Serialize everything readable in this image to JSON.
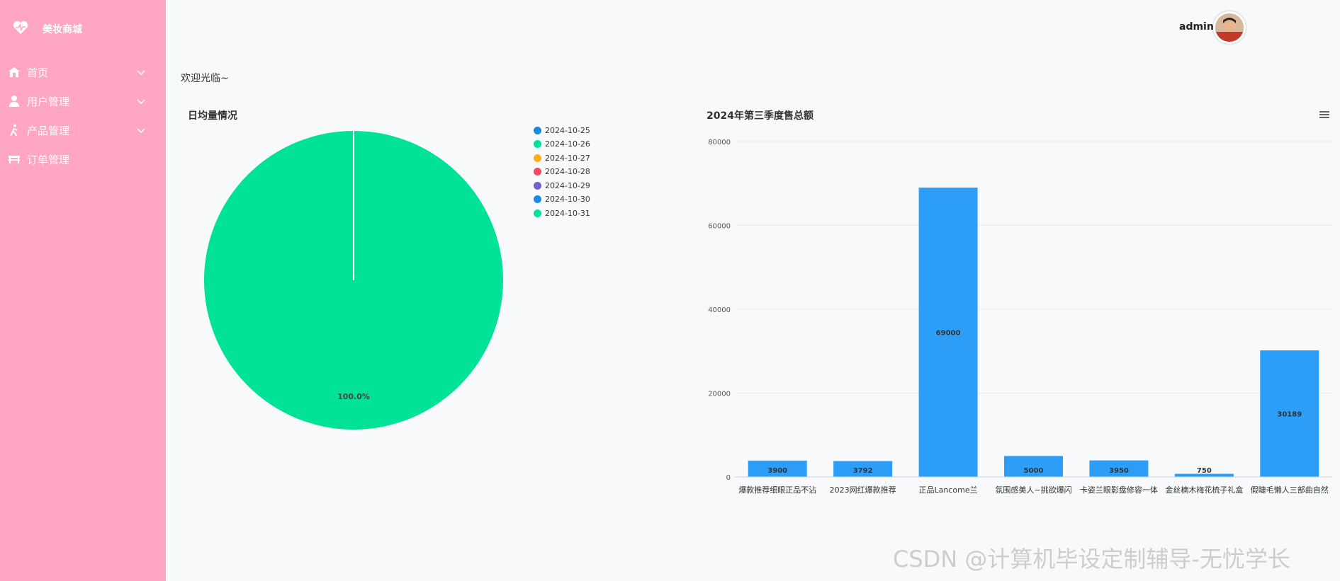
{
  "app": {
    "brand": "美妆商城"
  },
  "sidebar": {
    "items": [
      {
        "label": "首页",
        "icon": "home-icon",
        "expandable": true
      },
      {
        "label": "用户管理",
        "icon": "user-icon",
        "expandable": true
      },
      {
        "label": "产品管理",
        "icon": "walk-icon",
        "expandable": true
      },
      {
        "label": "订单管理",
        "icon": "bench-icon",
        "expandable": false
      }
    ]
  },
  "header": {
    "username": "admin"
  },
  "main": {
    "welcome": "欢迎光临~"
  },
  "colors": {
    "sidebar": "#ffa6c2",
    "bar": "#2c9ef7",
    "pie": "#00e396"
  },
  "charts": {
    "pie": {
      "title": "日均量情况",
      "slice_label": "100.0%"
    },
    "bar": {
      "title": "2024年第三季度售总额"
    }
  },
  "watermark": "CSDN @计算机毕设定制辅导-无忧学长",
  "chart_data": [
    {
      "type": "pie",
      "title": "日均量情况",
      "legend_position": "right",
      "slices": [
        {
          "name": "2024-10-25",
          "value": 0,
          "color": "#1e88e5"
        },
        {
          "name": "2024-10-26",
          "value": 100,
          "color": "#00e396"
        },
        {
          "name": "2024-10-27",
          "value": 0,
          "color": "#feb019"
        },
        {
          "name": "2024-10-28",
          "value": 0,
          "color": "#ff4560"
        },
        {
          "name": "2024-10-29",
          "value": 0,
          "color": "#775dd0"
        },
        {
          "name": "2024-10-30",
          "value": 0,
          "color": "#1e88e5"
        },
        {
          "name": "2024-10-31",
          "value": 0,
          "color": "#00e396"
        }
      ]
    },
    {
      "type": "bar",
      "title": "2024年第三季度售总额",
      "categories": [
        "爆款推荐细眼正品不沾",
        "2023网红爆款推荐",
        "正品Lancome兰",
        "氛围感美人~挑欲爆闪",
        "卡姿兰眼影盘修容一体",
        "金丝楠木梅花梳子礼盒",
        "假睫毛懒人三部曲自然"
      ],
      "values": [
        3900,
        3792,
        69000,
        5000,
        3950,
        750,
        30189
      ],
      "yticks": [
        0,
        20000,
        40000,
        60000,
        80000
      ],
      "ylim": [
        0,
        80000
      ],
      "grid": true
    }
  ]
}
